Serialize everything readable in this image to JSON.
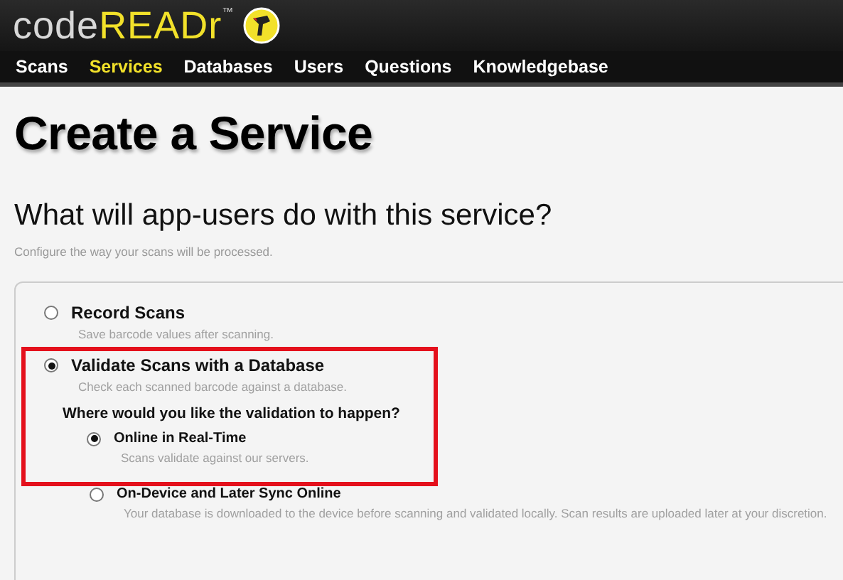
{
  "logo": {
    "light": "code",
    "accent": "READr",
    "mark": "™"
  },
  "nav": [
    {
      "label": "Scans",
      "selected": false
    },
    {
      "label": "Services",
      "selected": true
    },
    {
      "label": "Databases",
      "selected": false
    },
    {
      "label": "Users",
      "selected": false
    },
    {
      "label": "Questions",
      "selected": false
    },
    {
      "label": "Knowledgebase",
      "selected": false
    }
  ],
  "page_title": "Create a Service",
  "question": "What will app-users do with this service?",
  "hint": "Configure the way your scans will be processed.",
  "options": [
    {
      "label": "Record Scans",
      "description": "Save barcode values after scanning.",
      "selected": false,
      "highlighted": false
    },
    {
      "label": "Validate Scans with a Database",
      "description": "Check each scanned barcode against a database.",
      "selected": true,
      "highlighted": true,
      "sub_question": "Where would you like the validation to happen?",
      "sub_options": [
        {
          "label": "Online in Real-Time",
          "description": "Scans validate against our servers.",
          "selected": true,
          "highlighted": true
        },
        {
          "label": "On-Device and Later Sync Online",
          "description": "Your database is downloaded to the device before scanning and validated locally. Scan results are uploaded later at your discretion.",
          "selected": false,
          "highlighted": false
        }
      ]
    }
  ]
}
